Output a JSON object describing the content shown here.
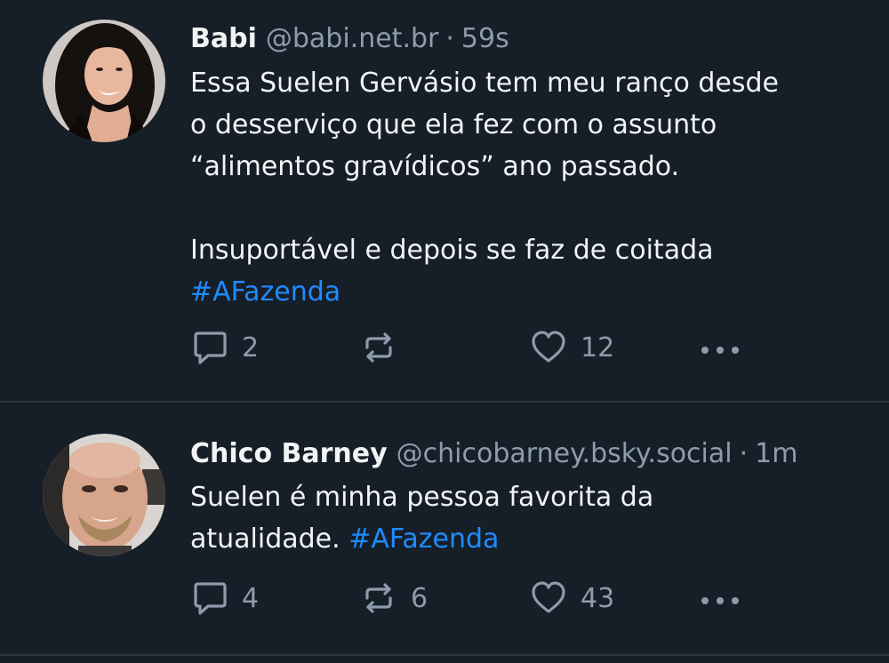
{
  "colors": {
    "background": "#161e27",
    "text": "#f1f3f5",
    "muted": "#8d9cad",
    "link": "#208bfe",
    "divider": "#2b3642"
  },
  "icons": {
    "reply": "speech-bubble-icon",
    "repost": "repost-arrows-icon",
    "like": "heart-icon",
    "more": "ellipsis-icon"
  },
  "posts": [
    {
      "author": "Babi",
      "handle": "@babi.net.br",
      "separator": "·",
      "time": "59s",
      "text_lines": [
        "Essa Suelen Gervásio tem meu ranço desde",
        "o desserviço que ela fez com o assunto",
        "“alimentos gravídicos” ano passado.",
        "",
        "Insuportável e depois se faz de coitada"
      ],
      "hashtag": "#AFazenda",
      "replies": "2",
      "reposts": "",
      "likes": "12"
    },
    {
      "author": "Chico Barney",
      "handle": "@chicobarney.bsky.social",
      "separator": "·",
      "time": "1m",
      "text_lines": [
        "Suelen é minha pessoa favorita da",
        "atualidade."
      ],
      "hashtag": "#AFazenda",
      "replies": "4",
      "reposts": "6",
      "likes": "43"
    }
  ]
}
